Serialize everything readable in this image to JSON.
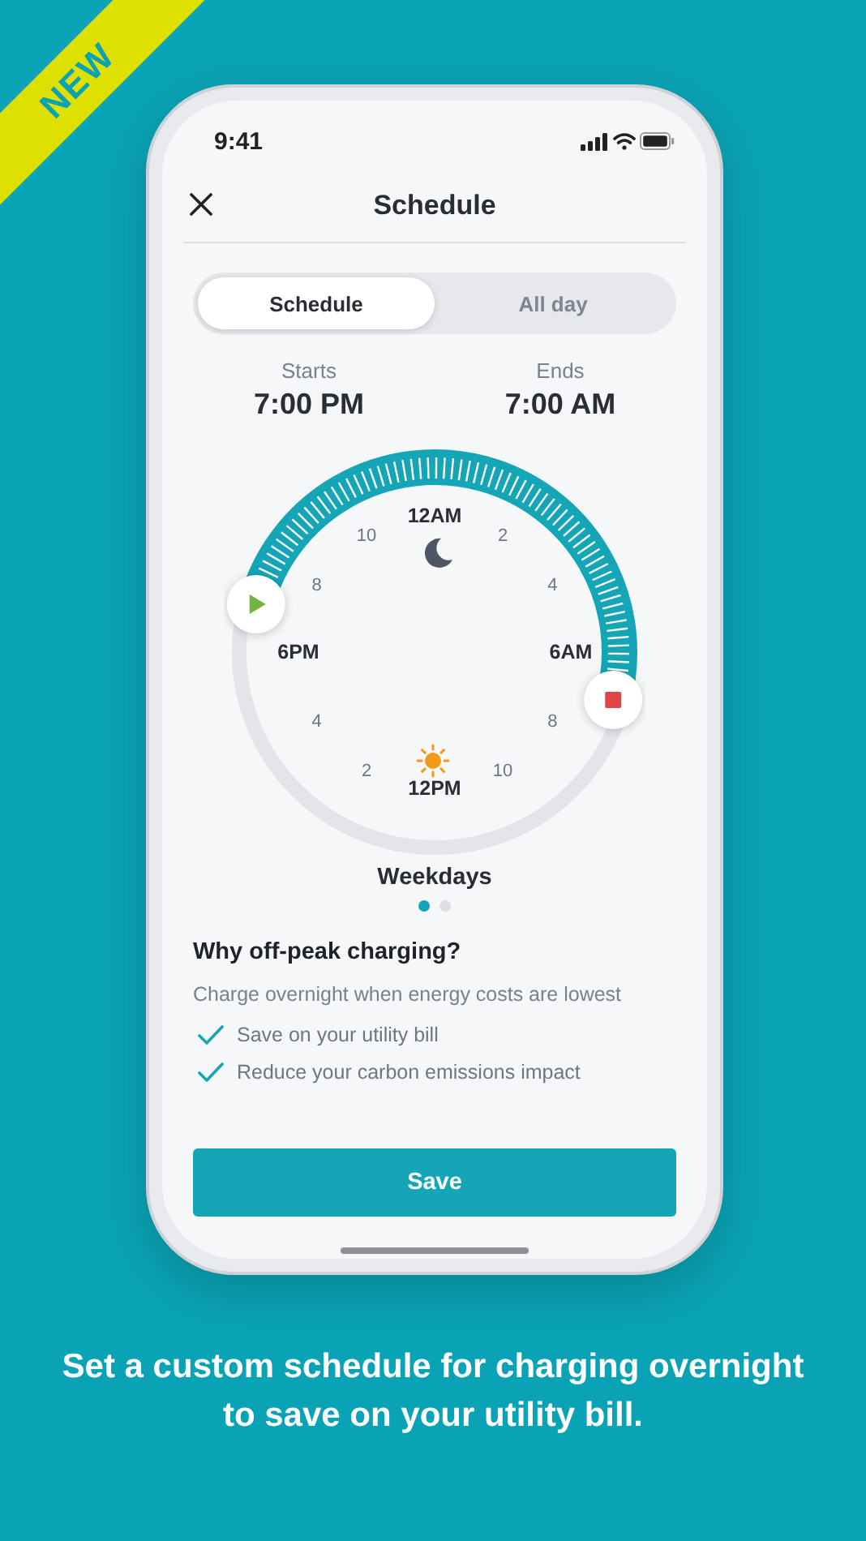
{
  "ribbon": {
    "label": "NEW"
  },
  "status_bar": {
    "time": "9:41"
  },
  "header": {
    "title": "Schedule"
  },
  "tabs": [
    {
      "label": "Schedule",
      "selected": true
    },
    {
      "label": "All day",
      "selected": false
    }
  ],
  "times": [
    {
      "label": "Starts",
      "value": "7:00 PM"
    },
    {
      "label": "Ends",
      "value": "7:00 AM"
    }
  ],
  "dial": {
    "hour_labels": [
      {
        "text": "12AM",
        "kind": "major"
      },
      {
        "text": "10",
        "kind": "minor"
      },
      {
        "text": "2",
        "kind": "minor"
      },
      {
        "text": "8",
        "kind": "minor"
      },
      {
        "text": "4",
        "kind": "minor"
      },
      {
        "text": "6PM",
        "kind": "major"
      },
      {
        "text": "6AM",
        "kind": "major"
      },
      {
        "text": "4",
        "kind": "minor"
      },
      {
        "text": "8",
        "kind": "minor"
      },
      {
        "text": "2",
        "kind": "minor"
      },
      {
        "text": "10",
        "kind": "minor"
      },
      {
        "text": "12PM",
        "kind": "major"
      }
    ],
    "caption": "Weekdays"
  },
  "pages": [
    {
      "selected": true
    },
    {
      "selected": false
    }
  ],
  "info": {
    "title": "Why off-peak charging?",
    "text": "Charge overnight when energy costs are lowest",
    "benefits": [
      "Save on your utility bill",
      "Reduce your carbon emissions impact"
    ]
  },
  "save_button": "Save",
  "caption": "Set a custom schedule for charging overnight to save on your utility bill."
}
